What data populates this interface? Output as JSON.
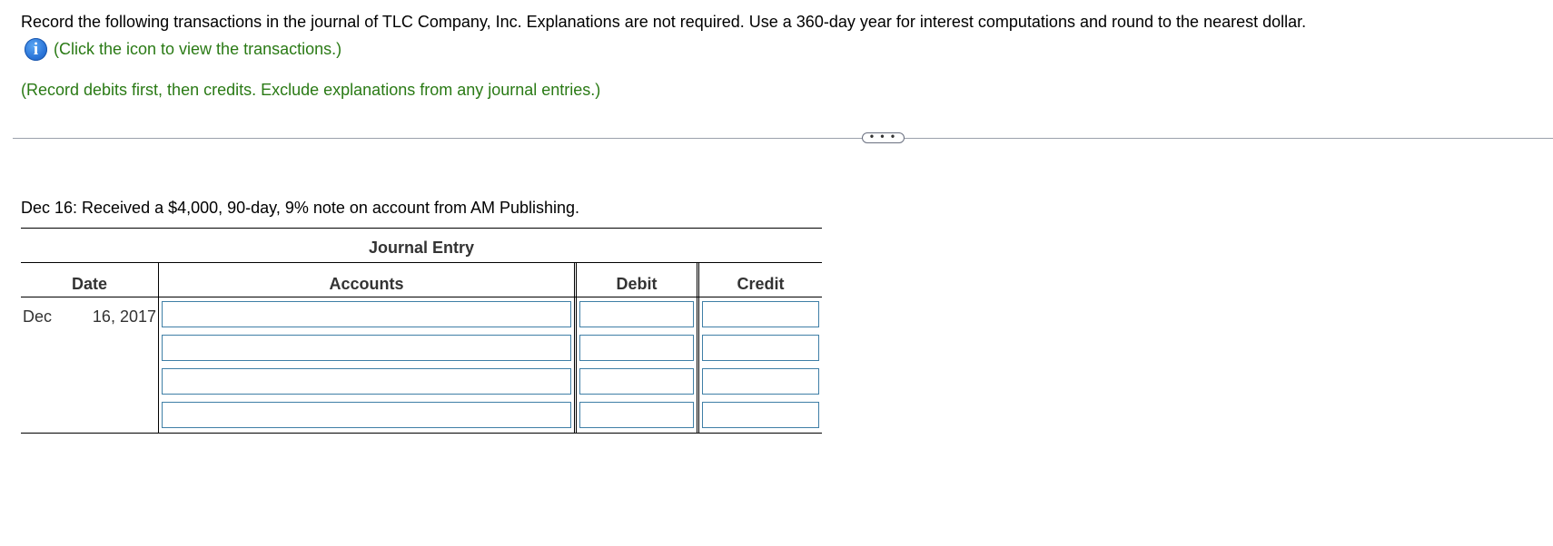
{
  "instructions": "Record the following transactions in the journal of TLC Company, Inc. Explanations are not required. Use a 360-day year for interest computations and round to the nearest dollar.",
  "info": {
    "icon": "info-icon",
    "icon_glyph": "i",
    "link_text": "(Click the icon to view the transactions.)"
  },
  "hint": "(Record debits first, then credits. Exclude explanations from any journal entries.)",
  "more_button": "• • •",
  "transaction_text": "Dec 16: Received a $4,000, 90-day, 9% note on account from AM Publishing.",
  "journal": {
    "title": "Journal Entry",
    "headers": {
      "date": "Date",
      "accounts": "Accounts",
      "debit": "Debit",
      "credit": "Credit"
    },
    "date_month": "Dec",
    "date_day_year": "16, 2017",
    "rows": [
      {
        "account": "",
        "debit": "",
        "credit": ""
      },
      {
        "account": "",
        "debit": "",
        "credit": ""
      },
      {
        "account": "",
        "debit": "",
        "credit": ""
      },
      {
        "account": "",
        "debit": "",
        "credit": ""
      }
    ]
  },
  "colors": {
    "green_text": "#2a7a15",
    "info_blue": "#2a74d8",
    "input_border": "#3f7fa6"
  }
}
